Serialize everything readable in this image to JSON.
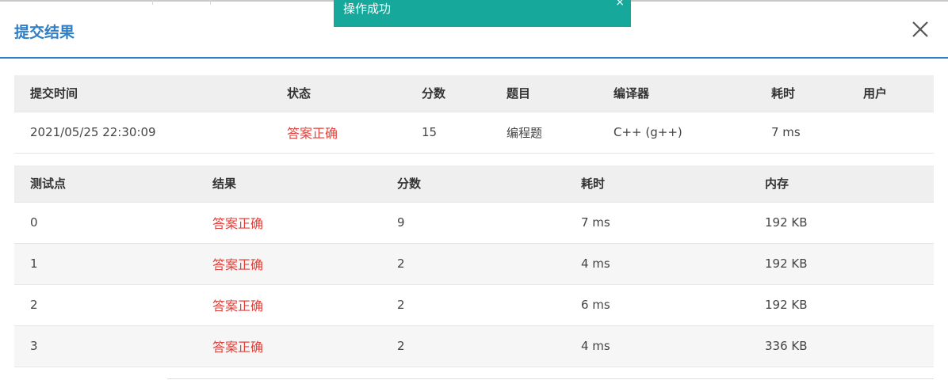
{
  "toast": {
    "message": "操作成功",
    "close": "×"
  },
  "modal": {
    "title": "提交结果",
    "close_icon": "close-icon"
  },
  "summary": {
    "headers": [
      "提交时间",
      "状态",
      "分数",
      "题目",
      "编译器",
      "耗时",
      "用户"
    ],
    "row": {
      "time": "2021/05/25 22:30:09",
      "status": "答案正确",
      "score": "15",
      "problem": "编程题",
      "compiler": "C++ (g++)",
      "duration": "7 ms",
      "user": ""
    }
  },
  "detail": {
    "headers": [
      "测试点",
      "结果",
      "分数",
      "耗时",
      "内存"
    ],
    "rows": [
      {
        "case": "0",
        "result": "答案正确",
        "score": "9",
        "time": "7 ms",
        "memory": "192 KB"
      },
      {
        "case": "1",
        "result": "答案正确",
        "score": "2",
        "time": "4 ms",
        "memory": "192 KB"
      },
      {
        "case": "2",
        "result": "答案正确",
        "score": "2",
        "time": "6 ms",
        "memory": "192 KB"
      },
      {
        "case": "3",
        "result": "答案正确",
        "score": "2",
        "time": "4 ms",
        "memory": "336 KB"
      }
    ]
  },
  "colors": {
    "accent": "#2f7ec8",
    "toast": "#16a89a",
    "accepted": "#e0413a"
  }
}
